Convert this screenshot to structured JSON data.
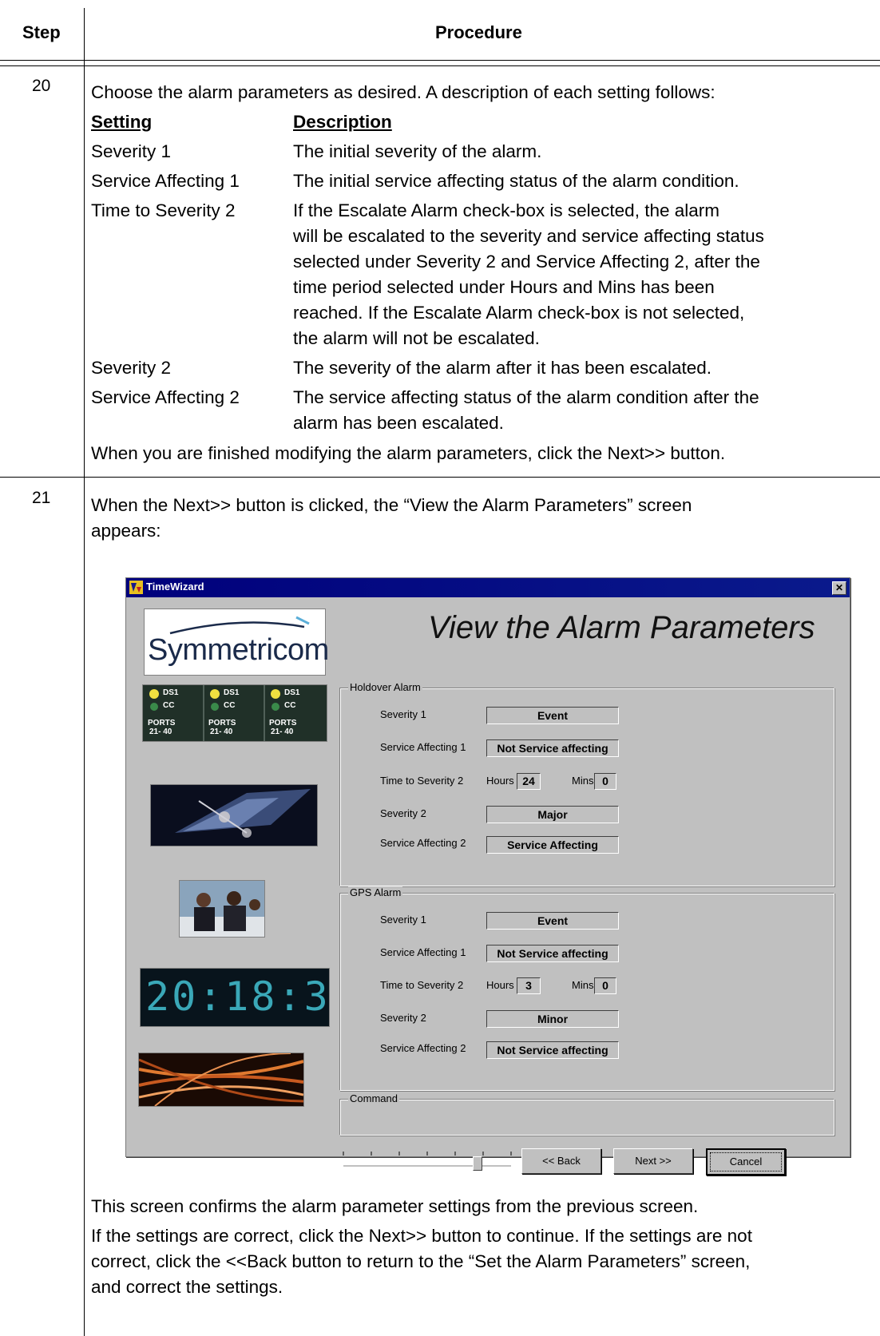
{
  "header": {
    "step": "Step",
    "procedure": "Procedure"
  },
  "step20": {
    "number": "20",
    "intro": "Choose the alarm parameters as desired. A description of each setting follows:",
    "col_setting": "Setting",
    "col_description": "Description",
    "rows": [
      {
        "setting": "Severity 1",
        "lines": [
          "The initial severity of the alarm."
        ]
      },
      {
        "setting": "Service Affecting 1",
        "lines": [
          "The initial service affecting status of the alarm condition."
        ]
      },
      {
        "setting": "Time to Severity 2",
        "lines": [
          "If the Escalate Alarm check-box is selected, the alarm",
          "will be escalated to the severity and service affecting status",
          "selected under Severity 2 and Service Affecting 2, after the",
          "time period selected under Hours and Mins has been",
          "reached. If the Escalate Alarm check-box is not selected,",
          "the alarm will not be escalated."
        ]
      },
      {
        "setting": "Severity 2",
        "lines": [
          "The severity of the alarm after it has been escalated."
        ]
      },
      {
        "setting": "Service Affecting 2",
        "lines": [
          "The service affecting status of the alarm condition after the",
          "alarm has been escalated."
        ]
      }
    ],
    "outro": "When you are finished modifying the alarm parameters, click the Next>> button."
  },
  "step21": {
    "number": "21",
    "intro_lines": [
      "When the Next>> button is clicked, the “View the Alarm Parameters” screen",
      "appears:"
    ],
    "after_1": "This screen confirms the alarm parameter settings from the previous screen.",
    "after_lines": [
      "If the settings are correct, click the Next>> button to continue. If the settings are not",
      "correct, click the <<Back button to return to the “Set the Alarm Parameters” screen,",
      "and correct the settings."
    ]
  },
  "window": {
    "title": "TimeWizard",
    "close": "✕",
    "logo": "Symmetricom",
    "heading": "View the Alarm Parameters",
    "clock": "20:18:3",
    "holdover": {
      "legend": "Holdover Alarm",
      "severity1_label": "Severity 1",
      "severity1": "Event",
      "service1_label": "Service Affecting 1",
      "service1": "Not Service affecting",
      "time_label": "Time to Severity 2",
      "hours_label": "Hours",
      "hours": "24",
      "mins_label": "Mins",
      "mins": "0",
      "severity2_label": "Severity 2",
      "severity2": "Major",
      "service2_label": "Service Affecting 2",
      "service2": "Service Affecting"
    },
    "gps": {
      "legend": "GPS Alarm",
      "severity1_label": "Severity 1",
      "severity1": "Event",
      "service1_label": "Service Affecting 1",
      "service1": "Not Service affecting",
      "time_label": "Time to Severity 2",
      "hours_label": "Hours",
      "hours": "3",
      "mins_label": "Mins",
      "mins": "0",
      "severity2_label": "Severity 2",
      "severity2": "Minor",
      "service2_label": "Service Affecting 2",
      "service2": "Not Service affecting"
    },
    "command_legend": "Command",
    "back": "<< Back",
    "next": "Next >>",
    "cancel": "Cancel",
    "progress": 0.8
  },
  "panel_labels": {
    "ds1": "DS1",
    "cc": "CC",
    "ports": "PORTS",
    "range": "21- 40"
  }
}
